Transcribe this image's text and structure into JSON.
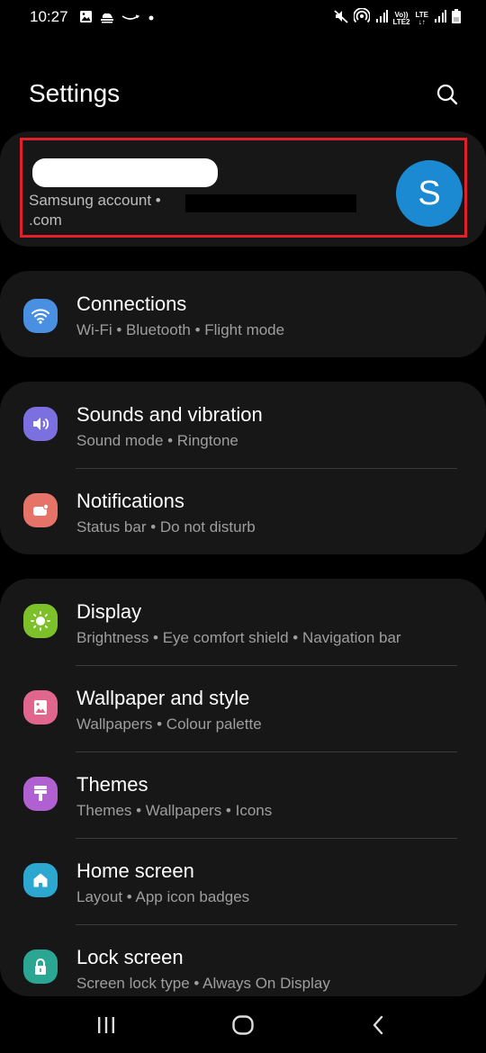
{
  "status_bar": {
    "time": "10:27",
    "left_icons": [
      "gallery-icon",
      "cloud-icon",
      "amazon-smile-icon",
      "dot-icon"
    ],
    "right_icons": [
      "mute-icon",
      "hotspot-icon",
      "signal-icon",
      "volte-lte2-icon",
      "lte-data-icon",
      "signal-icon",
      "battery-icon"
    ],
    "volte_label_top": "Vo))",
    "volte_label_bottom": "LTE2",
    "lte_label_top": "LTE",
    "lte_label_bottom": "↓↑"
  },
  "header": {
    "title": "Settings",
    "search_icon": "search-icon"
  },
  "account": {
    "subtitle": "Samsung account  •",
    "subtitle_line2": ".com",
    "avatar_letter": "S",
    "avatar_color": "#1b8ad3",
    "highlight_color": "#e0212b"
  },
  "groups": [
    {
      "items": [
        {
          "title": "Connections",
          "subtitle": "Wi-Fi  •  Bluetooth  •  Flight mode",
          "icon": "wifi-icon",
          "color": "#4a90e2"
        }
      ]
    },
    {
      "items": [
        {
          "title": "Sounds and vibration",
          "subtitle": "Sound mode  •  Ringtone",
          "icon": "speaker-icon",
          "color": "#7c6fe0"
        },
        {
          "title": "Notifications",
          "subtitle": "Status bar  •  Do not disturb",
          "icon": "notification-icon",
          "color": "#e57368"
        }
      ]
    },
    {
      "items": [
        {
          "title": "Display",
          "subtitle": "Brightness  •  Eye comfort shield  •  Navigation bar",
          "icon": "brightness-icon",
          "color": "#7cc129"
        },
        {
          "title": "Wallpaper and style",
          "subtitle": "Wallpapers  •  Colour palette",
          "icon": "wallpaper-icon",
          "color": "#e0668e"
        },
        {
          "title": "Themes",
          "subtitle": "Themes  •  Wallpapers  •  Icons",
          "icon": "paintbrush-icon",
          "color": "#b060d0"
        },
        {
          "title": "Home screen",
          "subtitle": "Layout  •  App icon badges",
          "icon": "home-icon",
          "color": "#2ba7d0"
        },
        {
          "title": "Lock screen",
          "subtitle": "Screen lock type  •  Always On Display",
          "icon": "lock-icon",
          "color": "#2aa692"
        }
      ]
    }
  ],
  "nav_bar": {
    "recents": "recents-icon",
    "home": "home-button-icon",
    "back": "back-icon"
  }
}
